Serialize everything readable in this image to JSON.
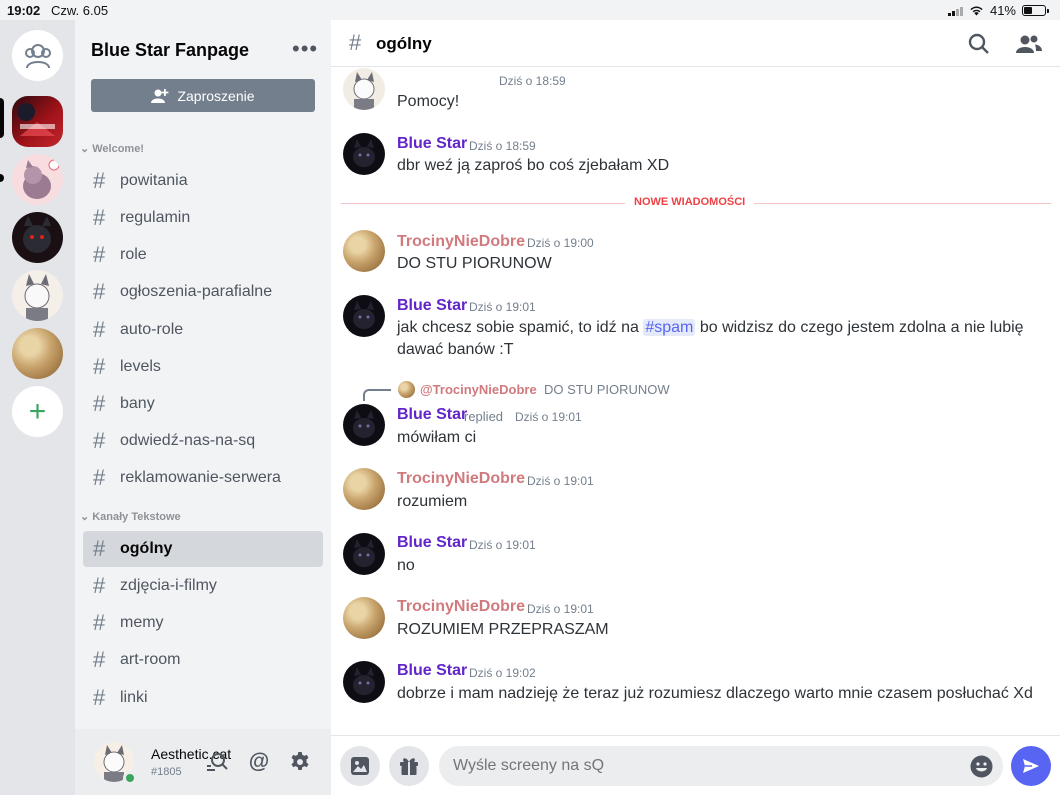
{
  "status_bar": {
    "time": "19:02",
    "date": "Czw. 6.05",
    "battery": "41%"
  },
  "server": {
    "name": "Blue Star Fanpage",
    "invite_label": "Zaproszenie"
  },
  "categories": [
    {
      "name": "Welcome!",
      "channels": [
        "powitania",
        "regulamin",
        "role",
        "ogłoszenia-parafialne",
        "auto-role",
        "levels",
        "bany",
        "odwiedź-nas-na-sq",
        "reklamowanie-serwera"
      ]
    },
    {
      "name": "Kanały Tekstowe",
      "channels": [
        "ogólny",
        "zdjęcia-i-filmy",
        "memy",
        "art-room",
        "linki"
      ]
    }
  ],
  "selected_channel": "ogólny",
  "user": {
    "name": "Aesthetic.cat",
    "tag": "#1805"
  },
  "chat": {
    "channel_title": "ogólny",
    "divider_label": "NOWE WIADOMOŚCI",
    "messages": [
      {
        "author": "",
        "time": "Dziś o 18:59",
        "text": "Pomocy!"
      },
      {
        "author": "Blue Star",
        "time": "Dziś o 18:59",
        "text": "dbr weź ją zaproś bo coś zjebałam XD"
      },
      {
        "author": "TrocinyNieDobre",
        "time": "Dziś o 19:00",
        "text": "DO STU PIORUNOW"
      },
      {
        "author": "Blue Star",
        "time": "Dziś o 19:01",
        "text_before": "jak chcesz sobie spamić, to idź na",
        "mention": "#spam",
        "text_after": "bo widzisz do czego jestem zdolna a nie lubię dawać banów :T"
      },
      {
        "author": "Blue Star",
        "replied": "replied",
        "time": "Dziś o 19:01",
        "text": "mówiłam ci",
        "reply_to_name": "@TrocinyNieDobre",
        "reply_to_text": "DO STU PIORUNOW"
      },
      {
        "author": "TrocinyNieDobre",
        "time": "Dziś o 19:01",
        "text": "rozumiem"
      },
      {
        "author": "Blue Star",
        "time": "Dziś o 19:01",
        "text": "no"
      },
      {
        "author": "TrocinyNieDobre",
        "time": "Dziś o 19:01",
        "text": "ROZUMIEM PRZEPRASZAM"
      },
      {
        "author": "Blue Star",
        "time": "Dziś o 19:02",
        "text": "dobrze i mam nadzieję że teraz już rozumiesz dlaczego warto mnie czasem posłuchać Xd"
      }
    ]
  },
  "composer": {
    "placeholder": "Wyśle screeny na sQ"
  },
  "colors": {
    "blurple": "#5865f2",
    "author_blue": "#6225c9",
    "author_pink": "#d17a7e",
    "new_messages_red": "#ed4245",
    "online_green": "#3ba55d"
  },
  "icons": [
    "friends-icon",
    "more-icon",
    "add-user-icon",
    "hash-icon",
    "search-icon",
    "members-icon",
    "mentions-icon",
    "settings-icon",
    "image-icon",
    "gift-icon",
    "emoji-icon",
    "send-icon",
    "plus-icon"
  ]
}
